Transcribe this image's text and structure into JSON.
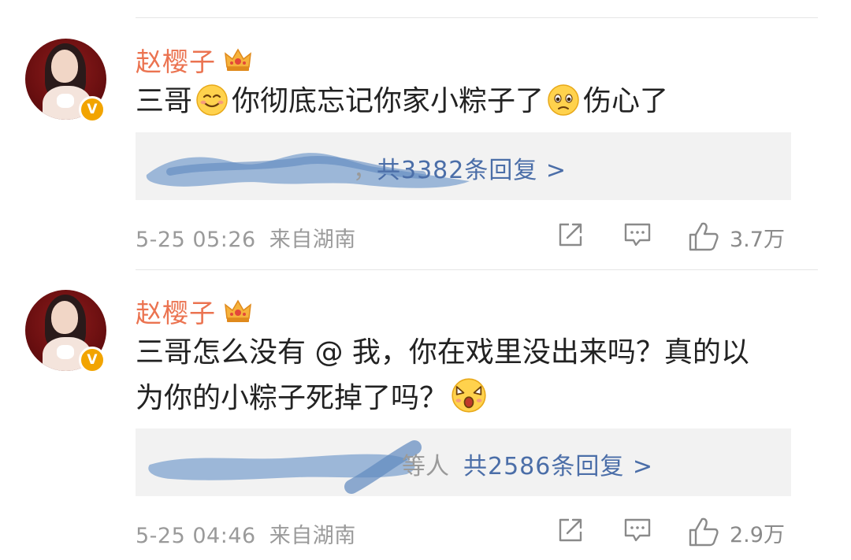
{
  "comments": [
    {
      "author": "赵樱子",
      "verified_badge": "V",
      "text_parts": [
        "三哥",
        "你彻底忘记你家小粽子了",
        "伤心了"
      ],
      "emojis": [
        "smile-emoji",
        "sad-emoji"
      ],
      "reply_fragment": "，",
      "reply_count_text": "共3382条回复 >",
      "timestamp": "5-25 05:26",
      "source": "来自湖南",
      "like_count": "3.7万"
    },
    {
      "author": "赵樱子",
      "verified_badge": "V",
      "text_line1": "三哥怎么没有 @ 我，你在戏里没出来吗？真的以",
      "text_line2": "为你的小粽子死掉了吗？",
      "emojis": [
        "shocked-emoji"
      ],
      "reply_fragment": "等人",
      "reply_count_text": "共2586条回复 >",
      "timestamp": "5-25 04:46",
      "source": "来自湖南",
      "like_count": "2.9万"
    }
  ],
  "icons": {
    "repost": "share-icon",
    "comment": "comment-icon",
    "like": "thumbs-up-icon",
    "crown": "crown-icon"
  },
  "colors": {
    "author": "#eb7350",
    "reply_link": "#4b6ea8",
    "meta": "#9a9a9a",
    "verified": "#f2a400"
  }
}
